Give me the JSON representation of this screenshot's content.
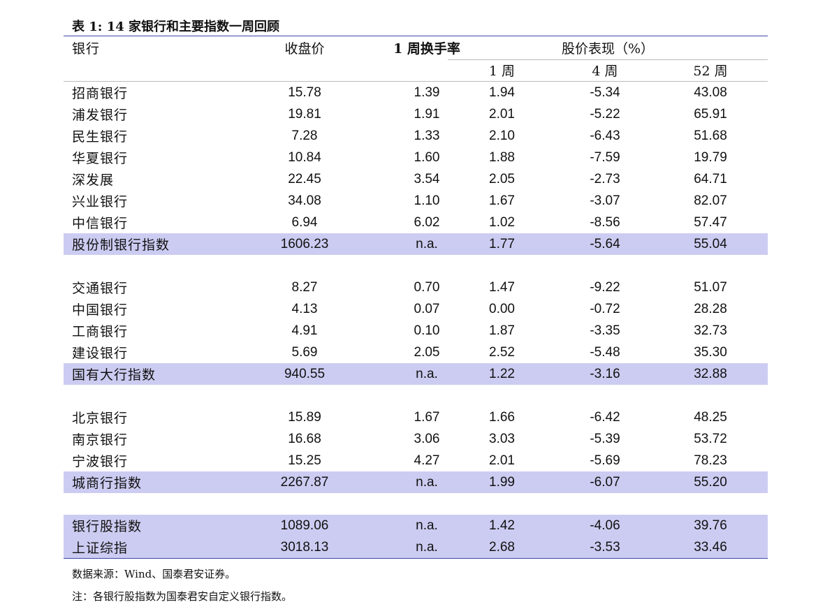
{
  "title": "表 1: 14 家银行和主要指数一周回顾",
  "header": {
    "bank": "银行",
    "close": "收盘价",
    "turnover": "1 周换手率",
    "performance": "股价表现（%）",
    "w1": "1 周",
    "w4": "4 周",
    "w52": "52 周"
  },
  "groups": [
    {
      "rows": [
        {
          "name": "招商银行",
          "close": "15.78",
          "turnover": "1.39",
          "w1": "1.94",
          "w4": "-5.34",
          "w52": "43.08"
        },
        {
          "name": "浦发银行",
          "close": "19.81",
          "turnover": "1.91",
          "w1": "2.01",
          "w4": "-5.22",
          "w52": "65.91"
        },
        {
          "name": "民生银行",
          "close": "7.28",
          "turnover": "1.33",
          "w1": "2.10",
          "w4": "-6.43",
          "w52": "51.68"
        },
        {
          "name": "华夏银行",
          "close": "10.84",
          "turnover": "1.60",
          "w1": "1.88",
          "w4": "-7.59",
          "w52": "19.79"
        },
        {
          "name": "深发展",
          "close": "22.45",
          "turnover": "3.54",
          "w1": "2.05",
          "w4": "-2.73",
          "w52": "64.71"
        },
        {
          "name": "兴业银行",
          "close": "34.08",
          "turnover": "1.10",
          "w1": "1.67",
          "w4": "-3.07",
          "w52": "82.07"
        },
        {
          "name": "中信银行",
          "close": "6.94",
          "turnover": "6.02",
          "w1": "1.02",
          "w4": "-8.56",
          "w52": "57.47"
        }
      ],
      "index": {
        "name": "股份制银行指数",
        "close": "1606.23",
        "turnover": "n.a.",
        "w1": "1.77",
        "w4": "-5.64",
        "w52": "55.04"
      }
    },
    {
      "rows": [
        {
          "name": "交通银行",
          "close": "8.27",
          "turnover": "0.70",
          "w1": "1.47",
          "w4": "-9.22",
          "w52": "51.07"
        },
        {
          "name": "中国银行",
          "close": "4.13",
          "turnover": "0.07",
          "w1": "0.00",
          "w4": "-0.72",
          "w52": "28.28"
        },
        {
          "name": "工商银行",
          "close": "4.91",
          "turnover": "0.10",
          "w1": "1.87",
          "w4": "-3.35",
          "w52": "32.73"
        },
        {
          "name": "建设银行",
          "close": "5.69",
          "turnover": "2.05",
          "w1": "2.52",
          "w4": "-5.48",
          "w52": "35.30"
        }
      ],
      "index": {
        "name": "国有大行指数",
        "close": "940.55",
        "turnover": "n.a.",
        "w1": "1.22",
        "w4": "-3.16",
        "w52": "32.88"
      }
    },
    {
      "rows": [
        {
          "name": "北京银行",
          "close": "15.89",
          "turnover": "1.67",
          "w1": "1.66",
          "w4": "-6.42",
          "w52": "48.25"
        },
        {
          "name": "南京银行",
          "close": "16.68",
          "turnover": "3.06",
          "w1": "3.03",
          "w4": "-5.39",
          "w52": "53.72"
        },
        {
          "name": "宁波银行",
          "close": "15.25",
          "turnover": "4.27",
          "w1": "2.01",
          "w4": "-5.69",
          "w52": "78.23"
        }
      ],
      "index": {
        "name": "城商行指数",
        "close": "2267.87",
        "turnover": "n.a.",
        "w1": "1.99",
        "w4": "-6.07",
        "w52": "55.20"
      }
    }
  ],
  "summary": [
    {
      "name": "银行股指数",
      "close": "1089.06",
      "turnover": "n.a.",
      "w1": "1.42",
      "w4": "-4.06",
      "w52": "39.76"
    },
    {
      "name": "上证综指",
      "close": "3018.13",
      "turnover": "n.a.",
      "w1": "2.68",
      "w4": "-3.53",
      "w52": "33.46"
    }
  ],
  "footnotes": {
    "source": "数据来源：Wind、国泰君安证券。",
    "note": "注：各银行股指数为国泰君安自定义银行指数。"
  },
  "colors": {
    "highlight": "#ccccf2",
    "rule": "#3b46a8"
  }
}
